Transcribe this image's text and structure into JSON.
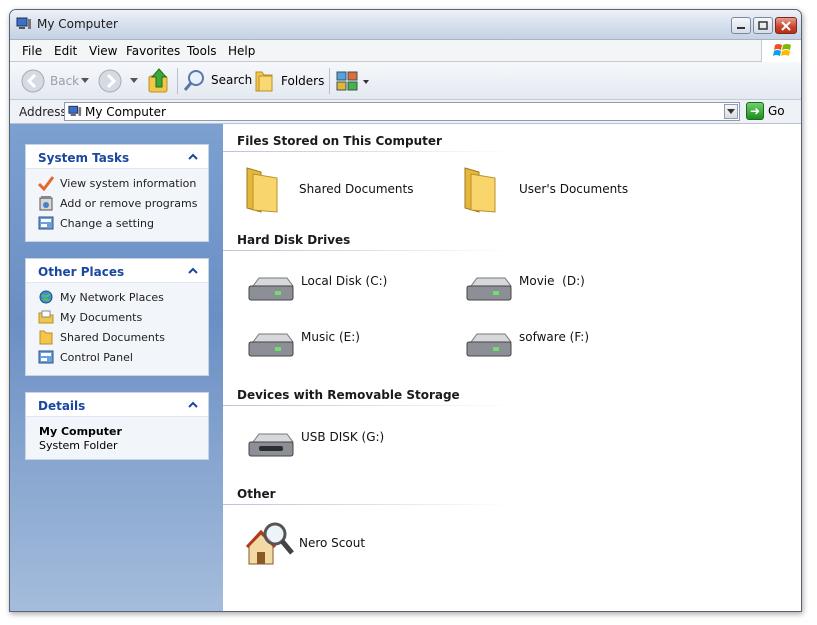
{
  "window": {
    "title": "My Computer"
  },
  "menu": [
    "File",
    "Edit",
    "View",
    "Favorites",
    "Tools",
    "Help"
  ],
  "toolbar": {
    "back": "Back",
    "search": "Search",
    "folders": "Folders"
  },
  "address": {
    "label": "Address",
    "value": "My Computer",
    "go": "Go"
  },
  "panels": {
    "system_tasks": {
      "title": "System Tasks",
      "items": [
        "View system information",
        "Add or remove programs",
        "Change a setting"
      ]
    },
    "other_places": {
      "title": "Other Places",
      "items": [
        "My Network Places",
        "My Documents",
        "Shared Documents",
        "Control Panel"
      ]
    },
    "details": {
      "title": "Details",
      "name": "My Computer",
      "type": "System Folder"
    }
  },
  "groups": {
    "files": {
      "title": "Files Stored on This Computer",
      "items": [
        "Shared Documents",
        "User's Documents"
      ]
    },
    "hdd": {
      "title": "Hard Disk Drives",
      "items": [
        "Local Disk (C:)",
        "Movie  (D:)",
        "Music (E:)",
        "sofware (F:)"
      ]
    },
    "removable": {
      "title": "Devices with Removable Storage",
      "items": [
        "USB DISK (G:)"
      ]
    },
    "other": {
      "title": "Other",
      "items": [
        "Nero Scout"
      ]
    }
  },
  "colors": {
    "panel_header": "#1a47a0",
    "left_pane": "#7ca0d0",
    "go_button": "#2fa52f"
  }
}
